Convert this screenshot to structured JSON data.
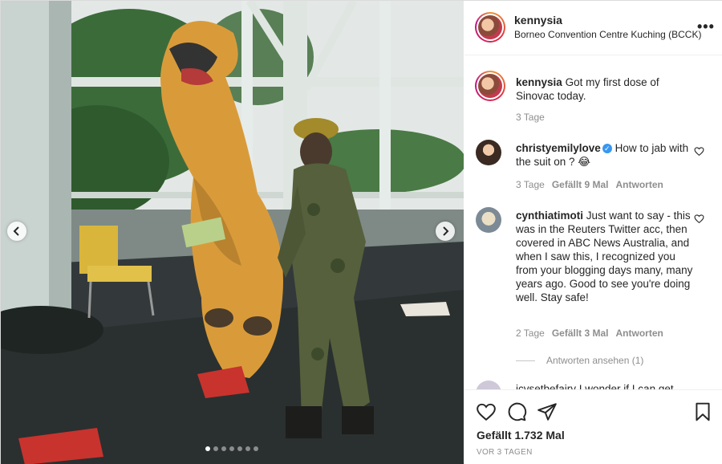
{
  "post": {
    "username": "kennysia",
    "location": "Borneo Convention Centre Kuching (BCCK)",
    "more_label": "•••",
    "carousel": {
      "dot_count": 7,
      "active_index": 0
    }
  },
  "caption": {
    "username": "kennysia",
    "text": "Got my first dose of Sinovac today.",
    "time": "3 Tage"
  },
  "comments": [
    {
      "username": "christyemilylove",
      "verified": true,
      "text": "How to jab with the suit on ? 😂",
      "time": "3 Tage",
      "likes": "Gefällt 9 Mal",
      "reply": "Antworten"
    },
    {
      "username": "cynthiatimoti",
      "verified": false,
      "text": "Just want to say - this was in the Reuters Twitter acc, then covered in ABC News Australia, and when I saw this, I recognized you from your blogging days many, many years ago. Good to see you're doing well. Stay safe!",
      "time": "2 Tage",
      "likes": "Gefällt 3 Mal",
      "reply": "Antworten",
      "view_replies": "Antworten ansehen (1)"
    }
  ],
  "partial_comment": "jcvsetbefairy I wonder if I can get",
  "footer": {
    "likes": "Gefällt 1.732 Mal",
    "date": "VOR 3 TAGEN"
  },
  "colors": {
    "verified": "#3897f0",
    "muted": "#8e8e8e",
    "text": "#262626"
  }
}
